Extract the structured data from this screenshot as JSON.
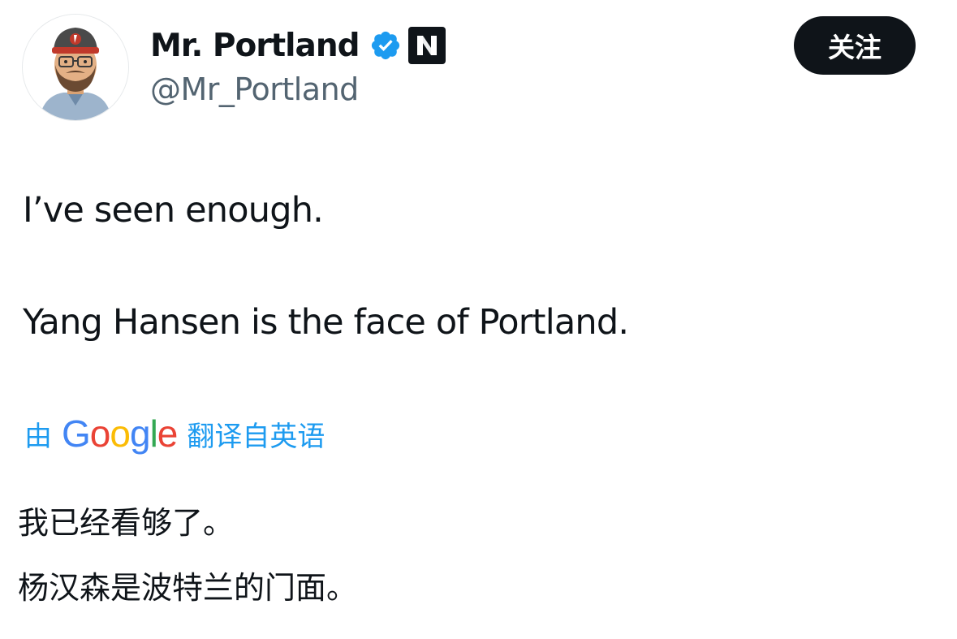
{
  "author": {
    "display_name": "Mr. Portland",
    "handle": "@Mr_Portland",
    "verified": true,
    "affiliate_badge_letter": "N"
  },
  "follow_button": {
    "label": "关注"
  },
  "tweet": {
    "lines": [
      "I’ve seen enough.",
      "Yang Hansen is the face of Portland."
    ]
  },
  "translation": {
    "prefix": "由",
    "provider": "Google",
    "provider_letters": [
      {
        "ch": "G",
        "color": "#4285F4"
      },
      {
        "ch": "o",
        "color": "#EA4335"
      },
      {
        "ch": "o",
        "color": "#FBBC05"
      },
      {
        "ch": "g",
        "color": "#4285F4"
      },
      {
        "ch": "l",
        "color": "#34A853"
      },
      {
        "ch": "e",
        "color": "#EA4335"
      }
    ],
    "suffix": "翻译自英语",
    "lines": [
      "我已经看够了。",
      "杨汉森是波特兰的门面。"
    ]
  },
  "colors": {
    "text_primary": "#0f1419",
    "text_secondary": "#536471",
    "link_blue": "#1d9bf0",
    "verified_blue": "#1d9bf0",
    "button_bg": "#0f1419"
  },
  "icons": {
    "avatar": "bitmoji-avatar-with-cap",
    "verified": "verified-badge-icon",
    "affiliate": "affiliate-badge-icon"
  }
}
